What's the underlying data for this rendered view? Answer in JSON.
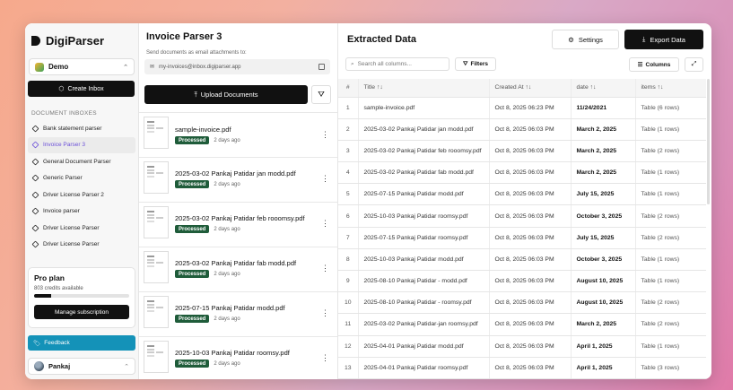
{
  "sidebar": {
    "brand": "DigiParser",
    "workspace": "Demo",
    "create_inbox": "Create Inbox",
    "inbox_heading": "DOCUMENT INBOXES",
    "inboxes": [
      {
        "label": "Bank statement parser",
        "active": false
      },
      {
        "label": "Invoice Parser 3",
        "active": true
      },
      {
        "label": "General Document Parser",
        "active": false
      },
      {
        "label": "Generic Parser",
        "active": false
      },
      {
        "label": "Driver License Parser 2",
        "active": false
      },
      {
        "label": "Invoice parser",
        "active": false
      },
      {
        "label": "Driver License Parser",
        "active": false
      },
      {
        "label": "Driver License Parser",
        "active": false
      }
    ],
    "plan": {
      "title": "Pro plan",
      "credits": "803 credits available",
      "usage_fraction": 0.18,
      "manage": "Manage subscription"
    },
    "feedback": "Feedback",
    "user": "Pankaj"
  },
  "parser": {
    "title": "Invoice Parser 3",
    "subtitle": "Send documents as email attachments to:",
    "email": "my-invoices@inbox.digiparser.app",
    "upload": "Upload Documents",
    "documents": [
      {
        "name": "sample-invoice.pdf",
        "status": "Processed",
        "ago": "2 days ago"
      },
      {
        "name": "2025-03-02 Pankaj Patidar jan modd.pdf",
        "status": "Processed",
        "ago": "2 days ago"
      },
      {
        "name": "2025-03-02 Pankaj Patidar feb rooomsy.pdf",
        "status": "Processed",
        "ago": "2 days ago"
      },
      {
        "name": "2025-03-02 Pankaj Patidar fab modd.pdf",
        "status": "Processed",
        "ago": "2 days ago"
      },
      {
        "name": "2025-07-15 Pankaj Patidar modd.pdf",
        "status": "Processed",
        "ago": "2 days ago"
      },
      {
        "name": "2025-10-03 Pankaj Patidar roomsy.pdf",
        "status": "Processed",
        "ago": "2 days ago"
      }
    ]
  },
  "extract": {
    "title": "Extracted Data",
    "settings": "Settings",
    "export": "Export Data",
    "search_placeholder": "Search all columns...",
    "filters": "Filters",
    "columns": "Columns",
    "headers": [
      "#",
      "Title",
      "Created At",
      "date",
      "items"
    ],
    "rows": [
      [
        "1",
        "sample-invoice.pdf",
        "Oct 8, 2025 06:23 PM",
        "11/24/2021",
        "Table (6 rows)"
      ],
      [
        "2",
        "2025-03-02 Pankaj Patidar jan modd.pdf",
        "Oct 8, 2025 06:03 PM",
        "March 2, 2025",
        "Table (1 rows)"
      ],
      [
        "3",
        "2025-03-02 Pankaj Patidar feb rooomsy.pdf",
        "Oct 8, 2025 06:03 PM",
        "March 2, 2025",
        "Table (2 rows)"
      ],
      [
        "4",
        "2025-03-02 Pankaj Patidar fab modd.pdf",
        "Oct 8, 2025 06:03 PM",
        "March 2, 2025",
        "Table (1 rows)"
      ],
      [
        "5",
        "2025-07-15 Pankaj Patidar modd.pdf",
        "Oct 8, 2025 06:03 PM",
        "July 15, 2025",
        "Table (1 rows)"
      ],
      [
        "6",
        "2025-10-03 Pankaj Patidar roomsy.pdf",
        "Oct 8, 2025 06:03 PM",
        "October 3, 2025",
        "Table (2 rows)"
      ],
      [
        "7",
        "2025-07-15 Pankaj Patidar roomsy.pdf",
        "Oct 8, 2025 06:03 PM",
        "July 15, 2025",
        "Table (2 rows)"
      ],
      [
        "8",
        "2025-10-03 Pankaj Patidar modd.pdf",
        "Oct 8, 2025 06:03 PM",
        "October 3, 2025",
        "Table (1 rows)"
      ],
      [
        "9",
        "2025-08-10 Pankaj Patidar - modd.pdf",
        "Oct 8, 2025 06:03 PM",
        "August 10, 2025",
        "Table (1 rows)"
      ],
      [
        "10",
        "2025-08-10 Pankaj Patidar - roomsy.pdf",
        "Oct 8, 2025 06:03 PM",
        "August 10, 2025",
        "Table (2 rows)"
      ],
      [
        "11",
        "2025-03-02 Pankaj Patidar-jan roomsy.pdf",
        "Oct 8, 2025 06:03 PM",
        "March 2, 2025",
        "Table (2 rows)"
      ],
      [
        "12",
        "2025-04-01 Pankaj Patidar modd.pdf",
        "Oct 8, 2025 06:03 PM",
        "April 1, 2025",
        "Table (1 rows)"
      ],
      [
        "13",
        "2025-04-01 Pankaj Patidar roomsy.pdf",
        "Oct 8, 2025 06:03 PM",
        "April 1, 2025",
        "Table (3 rows)"
      ]
    ]
  },
  "colors": {
    "accent_active": "#6b4fd8",
    "processed_badge": "#1f5c3a",
    "feedback_button": "#1492b8",
    "primary_button": "#111111"
  }
}
